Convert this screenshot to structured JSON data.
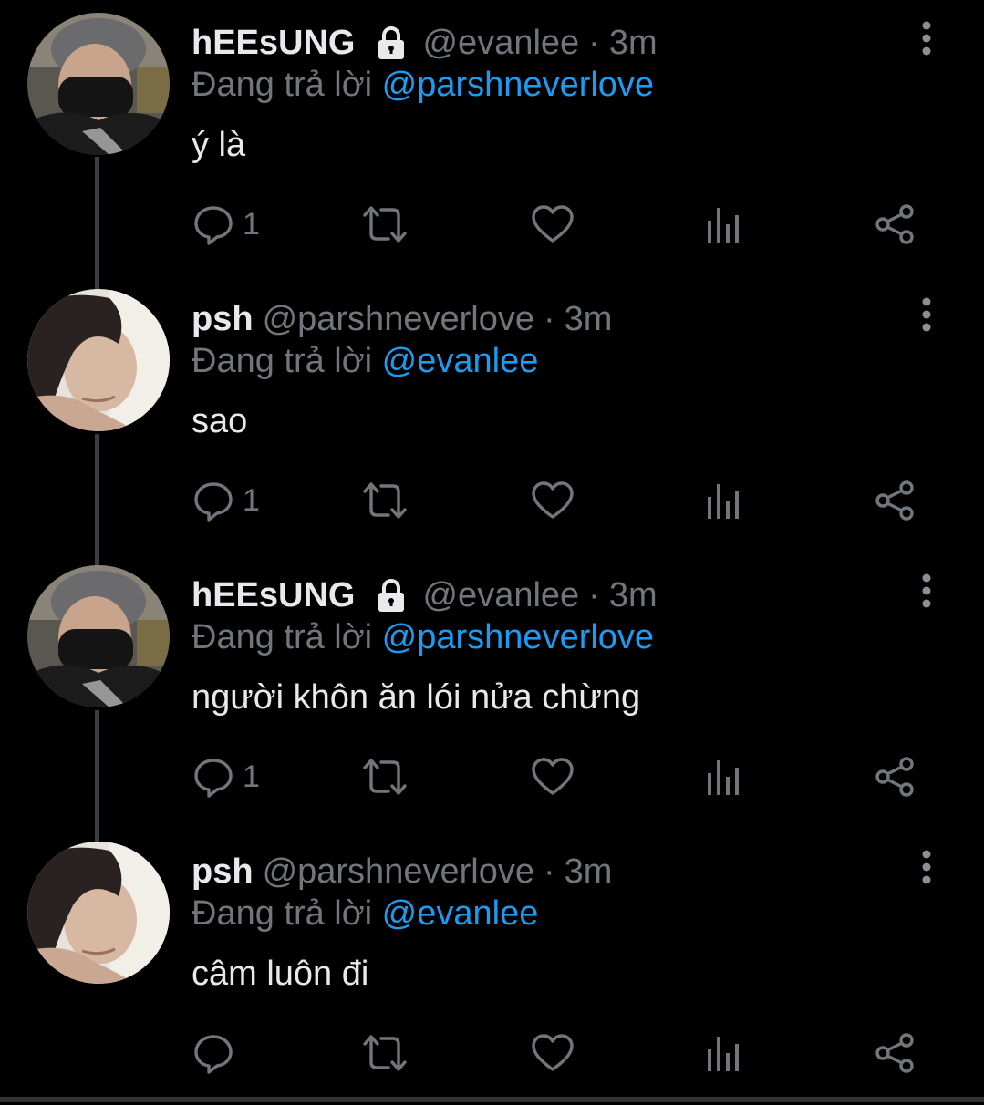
{
  "thread": {
    "tweets": [
      {
        "display_name": "hEEsUNG",
        "protected": true,
        "handle": "@evanlee",
        "separator": "·",
        "time": "3m",
        "reply_prefix": "Đang trả lời",
        "reply_to": "@parshneverlove",
        "text": "ý là",
        "reply_count": "1"
      },
      {
        "display_name": "psh",
        "protected": false,
        "handle": "@parshneverlove",
        "separator": "·",
        "time": "3m",
        "reply_prefix": "Đang trả lời",
        "reply_to": "@evanlee",
        "text": "sao",
        "reply_count": "1"
      },
      {
        "display_name": "hEEsUNG",
        "protected": true,
        "handle": "@evanlee",
        "separator": "·",
        "time": "3m",
        "reply_prefix": "Đang trả lời",
        "reply_to": "@parshneverlove",
        "text": "người khôn ăn lói nửa chừng",
        "reply_count": "1"
      },
      {
        "display_name": "psh",
        "protected": false,
        "handle": "@parshneverlove",
        "separator": "·",
        "time": "3m",
        "reply_prefix": "Đang trả lời",
        "reply_to": "@evanlee",
        "text": "câm luôn đi",
        "reply_count": ""
      }
    ]
  },
  "icons": {
    "reply": "reply-icon",
    "retweet": "retweet-icon",
    "like": "heart-icon",
    "views": "views-icon",
    "share": "share-icon",
    "more": "more-vertical-icon",
    "protected": "lock-icon"
  },
  "colors": {
    "background": "#000000",
    "primary_text": "#e7e9ea",
    "secondary_text": "#71767b",
    "accent": "#1d9bf0",
    "thread_line": "#3a3d41"
  }
}
